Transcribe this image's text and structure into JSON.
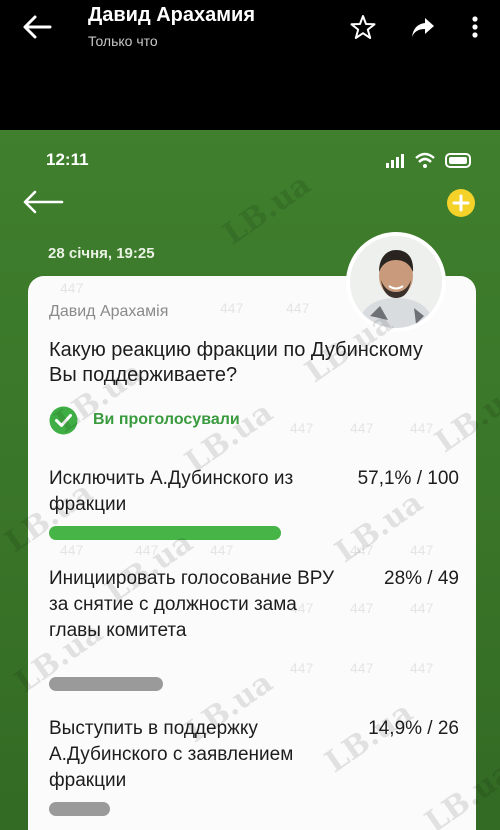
{
  "viewer": {
    "title": "Давид Арахамия",
    "subtitle": "Только что",
    "icons": [
      "back-arrow-icon",
      "star-icon",
      "share-icon",
      "more-vert-icon"
    ]
  },
  "phone": {
    "time": "12:11",
    "date": "28 січня, 19:25",
    "accent_color": "#3f7f2d",
    "plus_color": "#f4d22a"
  },
  "poll": {
    "author": "Давид Арахамія",
    "question": "Какую реакцию фракции по Дубинскому Вы поддерживаете?",
    "voted_text": "Ви проголосували",
    "options": [
      {
        "label": "Исключить А.Дубинского из фракции",
        "result": "57,1% / 100",
        "percent": 57.1,
        "color": "#46b446"
      },
      {
        "label": "Инициировать голосование ВРУ за снятие с должности зама главы комитета",
        "result": "28% / 49",
        "percent": 28,
        "color": "#9a9a9a"
      },
      {
        "label": "Выступить в поддержку А.Дубинского с заявлением фракции",
        "result": "14,9% / 26",
        "percent": 14.9,
        "color": "#9a9a9a"
      }
    ]
  },
  "watermark": {
    "logo": "LB.ua",
    "number": "447"
  }
}
